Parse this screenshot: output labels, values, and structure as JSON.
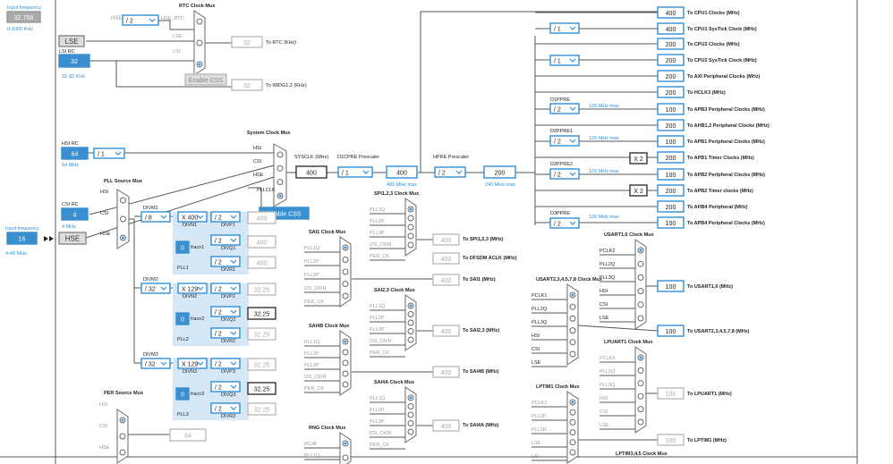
{
  "sources": {
    "input_frequency_label": "Input frequency",
    "lse_input_value": "32.768",
    "lse_range": "0-1000 KHz",
    "lse_label": "LSE",
    "lsi_rc_label": "LSI RC",
    "lsi_value": "32",
    "lsi_range": "31-32 KHz",
    "hsi_rc_label": "HSI RC",
    "hsi_value": "64",
    "hsi_freq": "64 MHz",
    "csi_rc_label": "CSI RC",
    "csi_value": "4",
    "csi_freq": "4 MHz",
    "hse_input_label": "Input frequency",
    "hse_input_value": "16",
    "hse_range": "4-48 MHz",
    "hse_label": "HSE"
  },
  "rtc": {
    "title": "RTC Clock Mux",
    "hse_label": "HSE",
    "hse_div": "/ 2",
    "hse_rtc_label": "HSE_RTC",
    "in_lse": "LSE",
    "in_lsi": "LSI",
    "out_value": "32",
    "out_label": "To RTC (KHz)",
    "enable_css": "Enable CSS",
    "iwdg_value": "32",
    "iwdg_label": "To IWDG1,2 (KHz)"
  },
  "system": {
    "title": "System Clock Mux",
    "in_hsi": "HSI",
    "in_csi": "CSI",
    "in_hse": "HSE",
    "in_pllclk": "PLLCLK",
    "enable_css": "Enable CSS",
    "hsi_div": "/ 1",
    "sysclk_label": "SYSCLK (MHz)",
    "sysclk_value": "400",
    "d1cpre_label": "D1CPRE Prescaler",
    "d1cpre_value": "/ 1",
    "d1_out_value": "400",
    "d1_max": "480 MHz max",
    "hpre_label": "HPRE Prescaler",
    "hpre_value": "/ 2",
    "hpre_out_value": "200",
    "hpre_max": "240 MHz max"
  },
  "pll": {
    "source_title": "PLL Source Mux",
    "in_hsi": "HSI",
    "in_csi": "CSI",
    "in_hse": "HSE",
    "divm1_label": "DIVM1",
    "divm1_value": "/ 8",
    "divn1_value": "X 400",
    "divn1_label": "DIVN1",
    "fracn1_label": "fracn1",
    "fracn1_value": "0",
    "divp1_value": "/ 2",
    "divp1_label": "DIVP1",
    "divq1_value": "/ 2",
    "divq1_label": "DIVQ1",
    "divr1_value": "/ 2",
    "divr1_label": "DIVR1",
    "pll1_label": "PLL1",
    "out_p1": "400",
    "out_q1": "400",
    "out_r1": "400",
    "divm2_label": "DIVM2",
    "divm2_value": "/ 32",
    "divn2_value": "X 129",
    "divn2_label": "DIVN2",
    "fracn2_label": "fracn2",
    "fracn2_value": "0",
    "divp2_value": "/ 2",
    "divp2_label": "DIVP2",
    "divq2_value": "/ 2",
    "divq2_label": "DIVQ2",
    "divr2_value": "/ 2",
    "divr2_label": "DIVR2",
    "pll2_label": "PLL2",
    "out_p2": "32.25",
    "out_q2": "32.25",
    "out_r2": "32.25",
    "divm3_label": "DIVM3",
    "divm3_value": "/ 32",
    "divn3_value": "X 129",
    "divn3_label": "DIVN3",
    "fracn3_label": "fracn3",
    "fracn3_value": "0",
    "divp3_value": "/ 2",
    "divp3_label": "DIVP3",
    "divq3_value": "/ 2",
    "divq3_label": "DIVQ3",
    "divr3_value": "/ 2",
    "divr3_label": "DIVR3",
    "pll3_label": "PLL3",
    "out_p3": "32.25",
    "out_q3": "32.25",
    "out_r3": "32.25"
  },
  "per": {
    "title": "PER Source Mux",
    "in_hsi": "HSI",
    "in_csi": "CSI",
    "in_hse": "HSE",
    "out_value": "64"
  },
  "spi": {
    "title": "SPI1,2,3 Clock Mux",
    "inputs": [
      "PLL1Q",
      "PLL2P",
      "PLL3P",
      "I2S_CKIN",
      "PER_CK"
    ],
    "out_value": "400",
    "out_label": "To SPI1,2,3 (MHz)",
    "dfsdm_value": "400",
    "dfsdm_label": "To DFSDM ACLK (MHz)"
  },
  "sai1": {
    "title": "SAI1 Clock Mux",
    "inputs": [
      "PLL1Q",
      "PLL2P",
      "PLL3P",
      "I2S_CKIN",
      "PER_CK"
    ],
    "out_value": "400",
    "out_label": "To SAI1 (MHz)"
  },
  "sai23": {
    "title": "SAI2,3 Clock Mux",
    "inputs": [
      "PLL1Q",
      "PLL2P",
      "PLL3P",
      "I2S_CKIN",
      "PER_CK"
    ],
    "out_value": "400",
    "out_label": "To SAI2,3 (MHz)"
  },
  "sai4b": {
    "title": "SAI4B Clock Mux",
    "inputs": [
      "PLL1Q",
      "PLL2P",
      "PLL3P",
      "I2S_CKIN",
      "PER_CK"
    ],
    "out_value": "400",
    "out_label": "To SAI4B (MHz)"
  },
  "sai4a": {
    "title": "SAI4A Clock Mux",
    "inputs": [
      "PLL1Q",
      "PLL2P",
      "PLL3P",
      "I2S_CKIN",
      "PER_CK"
    ],
    "out_value": "400",
    "out_label": "To SAI4A (MHz)"
  },
  "rng": {
    "title": "RNG Clock Mux",
    "inputs": [
      "RC48",
      "PLL1Q"
    ]
  },
  "usart16": {
    "title": "USART1,6 Clock Mux",
    "inputs": [
      "PCLK2",
      "PLL2Q",
      "PLL3Q",
      "HSI",
      "CSI",
      "LSE"
    ],
    "out_value": "100",
    "out_label": "To USART1,6 (MHz)"
  },
  "usart2": {
    "title": "USART2,3,4,5,7,8 Clock Mux",
    "inputs": [
      "PCLK1",
      "PLL2Q",
      "PLL3Q",
      "HSI",
      "CSI",
      "LSE"
    ],
    "out_value": "100",
    "out_label": "To USART2,3,4,5,7,8 (MHz)"
  },
  "lpuart1": {
    "title": "LPUART1 Clock Mux",
    "inputs": [
      "PCLK3",
      "PLL2Q",
      "PLL3Q",
      "HSI",
      "CSI",
      "LSE"
    ],
    "out_value": "100",
    "out_label": "To LPUART1 (MHz)"
  },
  "lptim1": {
    "title": "LPTIM1 Clock Mux",
    "inputs": [
      "PCLK1",
      "PLL2P",
      "PLL3R",
      "LSE",
      "LSI",
      "PER_CK"
    ],
    "out_value": "100",
    "out_label": "To LPTIM1 (MHz)"
  },
  "lptim345": {
    "title": "LPTIM3,4,5 Clock Mux"
  },
  "bus": {
    "cpu_div": "/ 1",
    "cpu2_div": "/ 1",
    "d1ppre": {
      "label": "D1PPRE",
      "value": "/ 2",
      "max": "120 MHz max"
    },
    "d2ppre1": {
      "label": "D2PPRE1",
      "value": "/ 2",
      "max": "120 MHz max"
    },
    "d2ppre2": {
      "label": "D2PPRE2",
      "value": "/ 2",
      "max": "120 MHz max"
    },
    "d3ppre": {
      "label": "D3PPRE",
      "value": "/ 2",
      "max": "120 MHz max"
    },
    "x2_a": "X 2",
    "x2_b": "X 2",
    "outputs": [
      {
        "value": "400",
        "label": "To CPU1 Clocks (MHz)"
      },
      {
        "value": "400",
        "label": "To CPU1 SysTick Clock (MHz)"
      },
      {
        "value": "200",
        "label": "To CPU2 Clocks (MHz)"
      },
      {
        "value": "200",
        "label": "To CPU2 SysTick Clock (MHz)"
      },
      {
        "value": "200",
        "label": "To AXI Peripheral Clocks (MHz)"
      },
      {
        "value": "200",
        "label": "To HCLK3 (MHz)"
      },
      {
        "value": "100",
        "label": "To APB3 Peripheral Clocks (MHz)"
      },
      {
        "value": "200",
        "label": "To AHB1,2 Peripheral Clocks (MHz)"
      },
      {
        "value": "100",
        "label": "To APB1 Peripheral Clocks (MHz)"
      },
      {
        "value": "200",
        "label": "To APB1 Timer Clocks (MHz)"
      },
      {
        "value": "100",
        "label": "To APB2 Peripheral Clocks (MHz)"
      },
      {
        "value": "200",
        "label": "To APB2 Timer clocks (MHz)"
      },
      {
        "value": "200",
        "label": "To AHB4 Peripheral (MHz)"
      },
      {
        "value": "100",
        "label": "To APB4 Peripheral Clocks (MHz)"
      }
    ]
  },
  "colors": {
    "accent": "#2f8fd8",
    "source_fill": "#3a8fd0",
    "pll_panel": "#d6e8f6",
    "line": "#444444",
    "disabled": "#bbbbbb",
    "label_blue": "#2f8fd8"
  }
}
